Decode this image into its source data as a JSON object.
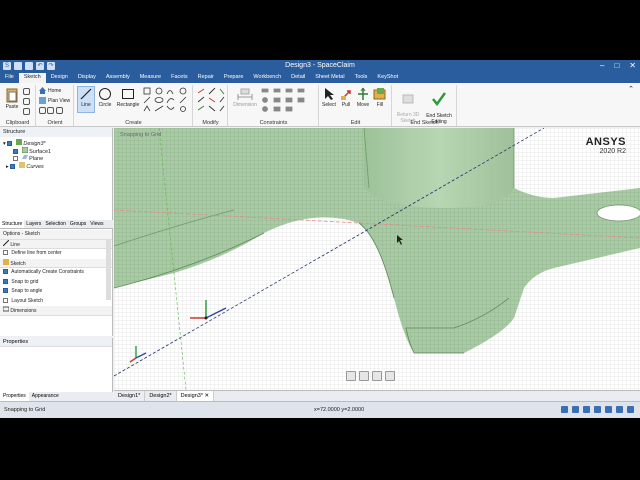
{
  "window": {
    "title": "Design3 - SpaceClaim"
  },
  "menu": {
    "tabs": [
      "File",
      "Sketch",
      "Design",
      "Display",
      "Assembly",
      "Measure",
      "Facets",
      "Repair",
      "Prepare",
      "Workbench",
      "Detail",
      "Sheet Metal",
      "Tools",
      "KeyShot"
    ],
    "active": "Sketch"
  },
  "ribbon": {
    "clipboard": {
      "paste": "Paste",
      "label": "Clipboard"
    },
    "orient": {
      "home": "Home",
      "plan_view": "Plan View",
      "label": "Orient"
    },
    "create": {
      "line": "Line",
      "circle": "Circle",
      "rectangle": "Rectangle",
      "label": "Create"
    },
    "modify": {
      "label": "Modify"
    },
    "constraints": {
      "dimension": "Dimension",
      "label": "Constraints"
    },
    "edit": {
      "select": "Select",
      "pull": "Pull",
      "move": "Move",
      "fill": "Fill",
      "label": "Edit"
    },
    "end_sketch": {
      "return_3d": "Return 3D\nSketch",
      "end_editing": "End Sketch\nEditing",
      "label": "End Sketch"
    }
  },
  "structure": {
    "title": "Structure",
    "items": [
      "Design3*",
      "Surface1",
      "Plane",
      "Curves"
    ]
  },
  "panel_tabs": [
    "Structure",
    "Layers",
    "Selection",
    "Groups",
    "Views"
  ],
  "options": {
    "title": "Options - Sketch",
    "line_section": "Line",
    "define_line_from_center": "Define line from center",
    "sketch_section": "Sketch",
    "auto_constraints": "Automatically Create Constraints",
    "snap_to_grid": "Snap to grid",
    "snap_to_angle": "Snap to angle",
    "layout_sketch": "Layout Sketch",
    "dimensions_section": "Dimensions"
  },
  "properties": {
    "title": "Properties"
  },
  "bottom_tabs": [
    "Properties",
    "Appearance"
  ],
  "viewport": {
    "label": "Snapping to Grid",
    "brand": "ANSYS",
    "version": "2020 R2"
  },
  "doc_tabs": [
    "Design1*",
    "Design2*",
    "Design3*"
  ],
  "status": {
    "text": "Snapping to Grid",
    "coords": "x=72.0000  y=2.0000"
  },
  "colors": {
    "accent": "#2a5d9e",
    "surface": "#a6c9a2"
  }
}
